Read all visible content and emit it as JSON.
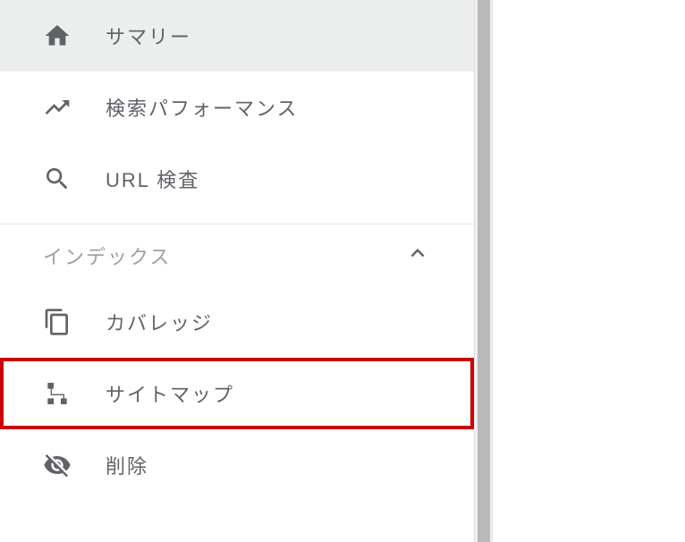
{
  "sidebar": {
    "topItems": [
      {
        "label": "サマリー"
      },
      {
        "label": "検索パフォーマンス"
      },
      {
        "label": "URL 検査"
      }
    ],
    "sections": [
      {
        "label": "インデックス",
        "items": [
          {
            "label": "カバレッジ"
          },
          {
            "label": "サイトマップ"
          },
          {
            "label": "削除"
          }
        ]
      }
    ]
  }
}
